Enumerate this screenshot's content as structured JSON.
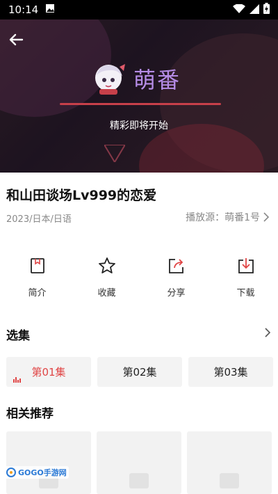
{
  "status_bar": {
    "time": "10:14"
  },
  "player": {
    "brand_name": "萌番",
    "loading_text": "精彩即将开始"
  },
  "video": {
    "title": "和山田谈场Lv999的恋爱",
    "meta": "2023/日本/日语",
    "source_label": "播放源：萌番1号"
  },
  "actions": [
    {
      "label": "简介",
      "icon": "bookmark-icon"
    },
    {
      "label": "收藏",
      "icon": "star-icon"
    },
    {
      "label": "分享",
      "icon": "share-icon"
    },
    {
      "label": "下载",
      "icon": "download-icon"
    }
  ],
  "episodes": {
    "title": "选集",
    "items": [
      {
        "label": "第01集",
        "active": true
      },
      {
        "label": "第02集",
        "active": false
      },
      {
        "label": "第03集",
        "active": false
      }
    ]
  },
  "recommendations": {
    "title": "相关推荐"
  },
  "watermark": {
    "text": "GOGO手游网"
  },
  "colors": {
    "accent": "#e04545",
    "brand": "#b58ce6",
    "loading_bar": "#c7404a"
  }
}
